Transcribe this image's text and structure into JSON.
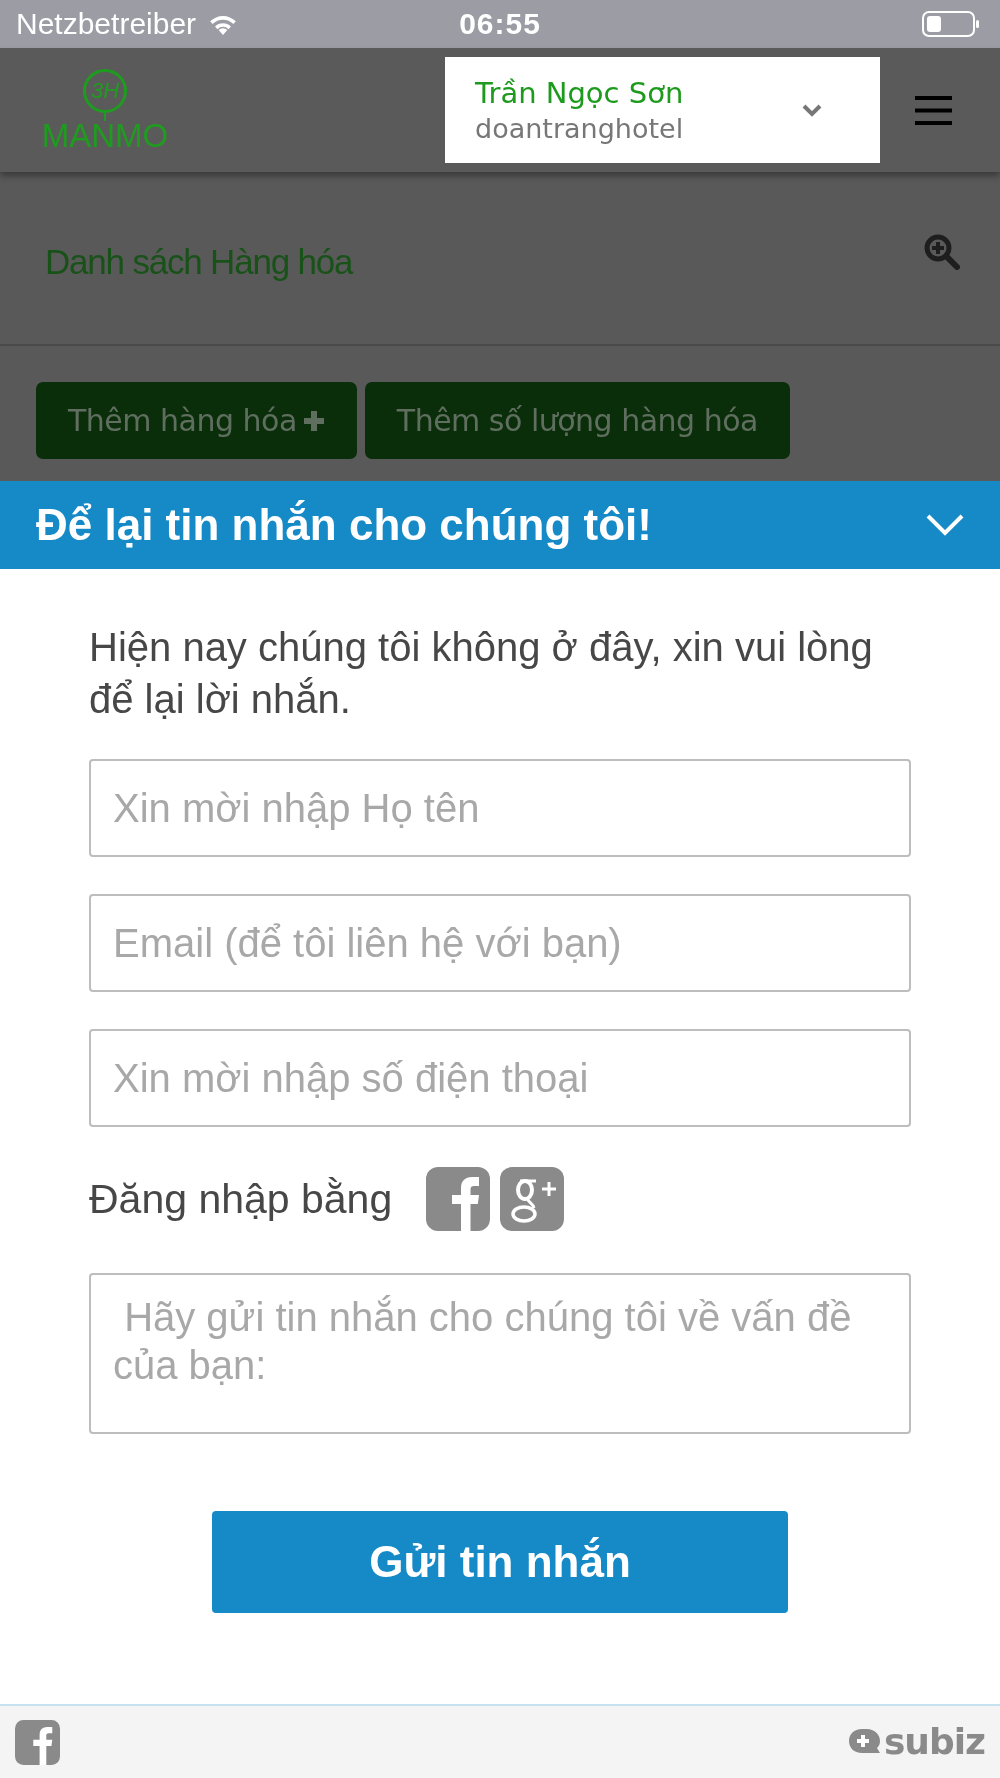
{
  "status_bar": {
    "carrier": "Netzbetreiber",
    "time": "06:55"
  },
  "header": {
    "logo": {
      "mark": "3H",
      "name": "MANMO"
    },
    "account": {
      "name": "Trần Ngọc Sơn",
      "username": "doantranghotel"
    }
  },
  "page": {
    "title": "Danh sách Hàng hóa",
    "buttons": [
      {
        "label": "Thêm hàng hóa",
        "kind": "add"
      },
      {
        "label": "Thêm số lượng hàng hóa",
        "kind": "plain"
      }
    ]
  },
  "chat": {
    "title": "Để lại tin nhắn cho chúng tôi!",
    "message": "Hiện nay chúng tôi không ở đây, xin vui lòng để lại lời nhắn.",
    "fields": [
      {
        "placeholder": "Xin mời nhập Họ tên"
      },
      {
        "placeholder": "Email (để tôi liên hệ với bạn)"
      },
      {
        "placeholder": "Xin mời nhập số điện thoại"
      }
    ],
    "login_label": "Đăng nhập bằng",
    "message_field": {
      "placeholder": " Hãy gửi tin nhắn cho chúng tôi về vấn đề của bạn:"
    },
    "submit": "Gửi tin nhắn",
    "footer": {
      "brand": "subiz"
    }
  }
}
